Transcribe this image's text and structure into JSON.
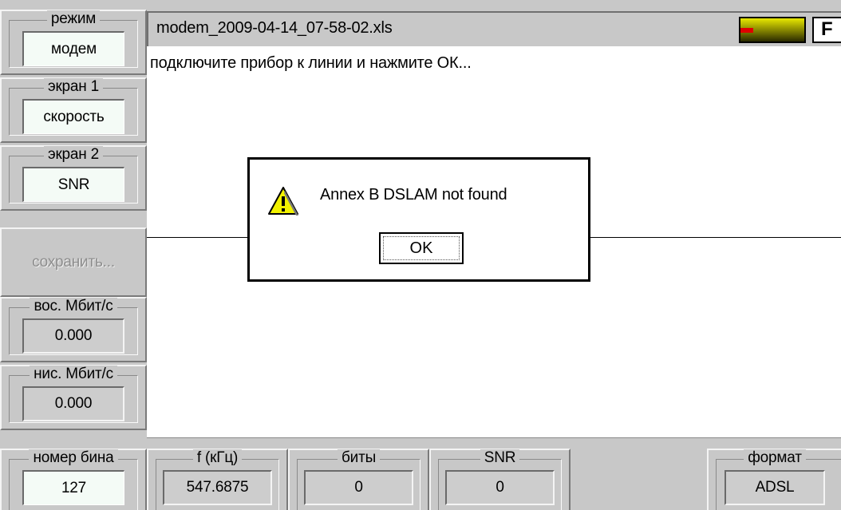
{
  "left_panel": {
    "mode": {
      "label": "режим",
      "value": "модем"
    },
    "screen1": {
      "label": "экран 1",
      "value": "скорость"
    },
    "screen2": {
      "label": "экран 2",
      "value": "SNR"
    },
    "save_label": "сохранить...",
    "upstream": {
      "label": "вос. Мбит/с",
      "value": "0.000"
    },
    "downstream": {
      "label": "нис. Мбит/с",
      "value": "0.000"
    }
  },
  "title_bar": {
    "filename": "modem_2009-04-14_07-58-02.xls",
    "f_button_label": "F",
    "level_colors": {
      "low": "#e00000",
      "high": "#e8e800"
    }
  },
  "main": {
    "hint": "подключите прибор к линии и нажмите ОК..."
  },
  "dialog": {
    "icon": "warning-icon",
    "message": "Annex B DSLAM not found",
    "ok_label": "OK"
  },
  "bottom_panel": {
    "bin_number": {
      "label": "номер бина",
      "value": "127"
    },
    "frequency": {
      "label": "f (кГц)",
      "value": "547.6875"
    },
    "bits": {
      "label": "биты",
      "value": "0"
    },
    "snr": {
      "label": "SNR",
      "value": "0"
    },
    "format": {
      "label": "формат",
      "value": "ADSL"
    }
  }
}
